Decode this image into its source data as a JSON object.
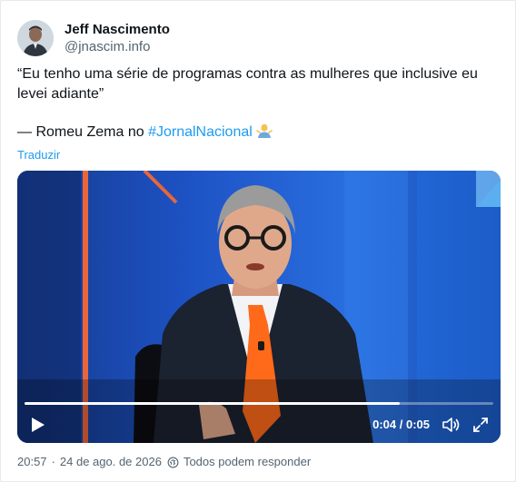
{
  "author": {
    "display_name": "Jeff Nascimento",
    "handle": "@jnascim.info"
  },
  "tweet": {
    "quote_text": "“Eu tenho uma série de programas contra as mulheres que inclusive eu levei adiante”",
    "attribution_prefix": "— Romeu Zema no ",
    "hashtag": "#JornalNacional",
    "emoji": "person-shrugging-emoji"
  },
  "translate_label": "Traduzir",
  "video": {
    "current_time": "0:04",
    "duration": "0:05",
    "time_display": "0:04 / 0:05",
    "progress_fraction": 0.8,
    "accent": "#1d9bf0"
  },
  "footer": {
    "time": "20:57",
    "date": "24 de ago. de 2026",
    "reply_setting": "Todos podem responder"
  },
  "colors": {
    "link": "#1d9bf0",
    "text": "#0f1419",
    "secondary": "#536471"
  }
}
